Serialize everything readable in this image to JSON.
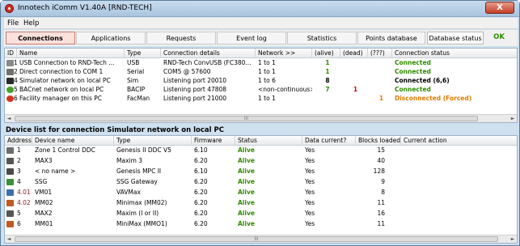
{
  "window": {
    "title": "Innotech iComm V1.40A [RND-TECH]",
    "close_label": "X"
  },
  "menu": [
    "File",
    "Help"
  ],
  "tabs": [
    "Connections",
    "Applications",
    "Requests",
    "Event log",
    "Statistics",
    "Points database"
  ],
  "database_status": {
    "label": "Database status",
    "value": "OK"
  },
  "connections": {
    "headers": [
      "ID",
      "Name",
      "Type",
      "Connection details",
      "Network >>",
      "(alive)",
      "(dead)",
      "(???)",
      "Connection status"
    ],
    "rows": [
      {
        "id": "1",
        "name": "USB Connection to RND-Tech ...",
        "type": "USB",
        "details": "RND-Tech ConvUSB (FC380...",
        "network": "1 to 1",
        "alive": "1",
        "dead": "",
        "unknown": "",
        "status": "Connected",
        "status_color": "#2e8b00",
        "icon": "usb-icon"
      },
      {
        "id": "2",
        "name": "Direct connection to COM 1",
        "type": "Serial",
        "details": "COM5 @ 57600",
        "network": "1 to 1",
        "alive": "1",
        "dead": "",
        "unknown": "",
        "status": "Connected",
        "status_color": "#2e8b00",
        "icon": "serial-icon"
      },
      {
        "id": "4",
        "name": "Simulator network on local PC",
        "type": "Sim",
        "details": "Listening port 20010",
        "network": "1 to 6",
        "alive": "8",
        "dead": "",
        "unknown": "",
        "status": "Connected (6,6)",
        "status_color": "#000000",
        "icon": "simulator-icon"
      },
      {
        "id": "5",
        "name": "BACnet network on local PC",
        "type": "BACIP",
        "details": "Listening port 47808",
        "network": "<non-continuous>",
        "alive": "7",
        "dead": "1",
        "unknown": "",
        "status": "Connected",
        "status_color": "#2e8b00",
        "icon": "bacnet-icon"
      },
      {
        "id": "6",
        "name": "Facility manager on this PC",
        "type": "FacMan",
        "details": "Listening port 21000",
        "network": "1 to 1",
        "alive": "",
        "dead": "",
        "unknown": "1",
        "status": "Disconnected (Forced)",
        "status_color": "#e27a00",
        "icon": "facility-manager-icon"
      }
    ]
  },
  "device_section_title": "Device list for connection Simulator network on local PC",
  "devices": {
    "headers": [
      "Address",
      "Device name",
      "Type",
      "Firmware",
      "Status",
      "Data current?",
      "Blocks loaded",
      "Current action"
    ],
    "rows": [
      {
        "address": "1",
        "name": "Zone 1 Control DDC",
        "type": "Genesis II DDC V5",
        "firmware": "6.10",
        "status": "Alive",
        "current": "Yes",
        "blocks": "15",
        "icon": "ddc-controller-icon"
      },
      {
        "address": "2",
        "name": "MAX3",
        "type": "Maxim 3",
        "firmware": "6.20",
        "status": "Alive",
        "current": "Yes",
        "blocks": "40",
        "icon": "maxim-controller-icon"
      },
      {
        "address": "3",
        "name": "< no name >",
        "type": "Genesis MPC II",
        "firmware": "6.10",
        "status": "Alive",
        "current": "Yes",
        "blocks": "128",
        "icon": "mpc-controller-icon"
      },
      {
        "address": "4",
        "name": "SSG",
        "type": "SSG Gateway",
        "firmware": "6.20",
        "status": "Alive",
        "current": "Yes",
        "blocks": "9",
        "icon": "gateway-icon"
      },
      {
        "address": "4.01",
        "name": "VM01",
        "type": "VAVMax",
        "firmware": "6.20",
        "status": "Alive",
        "current": "Yes",
        "blocks": "8",
        "icon": "vav-controller-icon"
      },
      {
        "address": "4.02",
        "name": "MM02",
        "type": "Minimax (MM02)",
        "firmware": "6.20",
        "status": "Alive",
        "current": "Yes",
        "blocks": "11",
        "icon": "minimax-controller-icon"
      },
      {
        "address": "5",
        "name": "MAX2",
        "type": "Maxim (I or II)",
        "firmware": "6.20",
        "status": "Alive",
        "current": "Yes",
        "blocks": "16",
        "icon": "maxim-controller-icon"
      },
      {
        "address": "6",
        "name": "MM01",
        "type": "MiniMax (MMO1)",
        "firmware": "6.20",
        "status": "Alive",
        "current": "Yes",
        "blocks": "11",
        "icon": "minimax-controller-icon"
      }
    ]
  },
  "scrollbar": {
    "thumb_label": "III",
    "left_arrow": "◄",
    "right_arrow": "►"
  }
}
